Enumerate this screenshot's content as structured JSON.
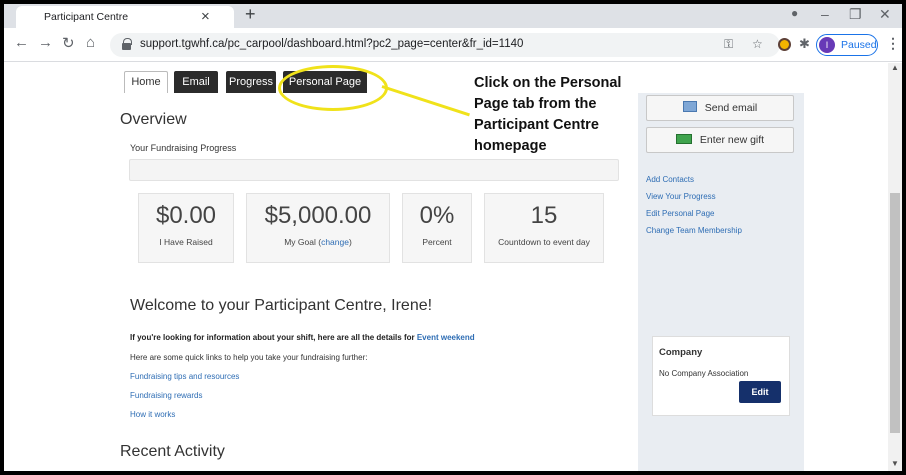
{
  "browser": {
    "tab_title": "Participant Centre",
    "tab_close": "×",
    "new_tab": "+",
    "url": "support.tgwhf.ca/pc_carpool/dashboard.html?pc2_page=center&fr_id=1140",
    "profile_initial": "I",
    "profile_status": "Paused"
  },
  "page_tabs": [
    "Home",
    "Email",
    "Progress",
    "Personal Page"
  ],
  "overview": {
    "heading": "Overview",
    "progress_label": "Your Fundraising Progress",
    "progress_fraction": 0.0,
    "stats": [
      {
        "value": "$0.00",
        "label": "I Have Raised"
      },
      {
        "value": "$5,000.00",
        "label": "My Goal",
        "link": "change"
      },
      {
        "value": "0%",
        "label": "Percent"
      },
      {
        "value": "15",
        "label": "Countdown to event day"
      }
    ]
  },
  "welcome": {
    "heading": "Welcome to your Participant Centre, Irene!",
    "shift_text": "If you're looking for information about your shift, here are all the details for",
    "shift_link": "Event weekend",
    "quick_text": "Here are some quick links to help you take your fundraising further:",
    "links": [
      "Fundraising tips and resources",
      "Fundraising rewards",
      "How it works"
    ]
  },
  "recent": {
    "heading": "Recent Activity"
  },
  "sidebar": {
    "send_email": "Send email",
    "enter_gift": "Enter new gift",
    "links": [
      "Add Contacts",
      "View Your Progress",
      "Edit Personal Page",
      "Change Team Membership"
    ],
    "company": {
      "title": "Company",
      "text": "No Company Association",
      "edit": "Edit"
    }
  },
  "annotation": {
    "text": "Click on the Personal Page tab from the Participant Centre homepage",
    "color": "#f0e21a"
  }
}
